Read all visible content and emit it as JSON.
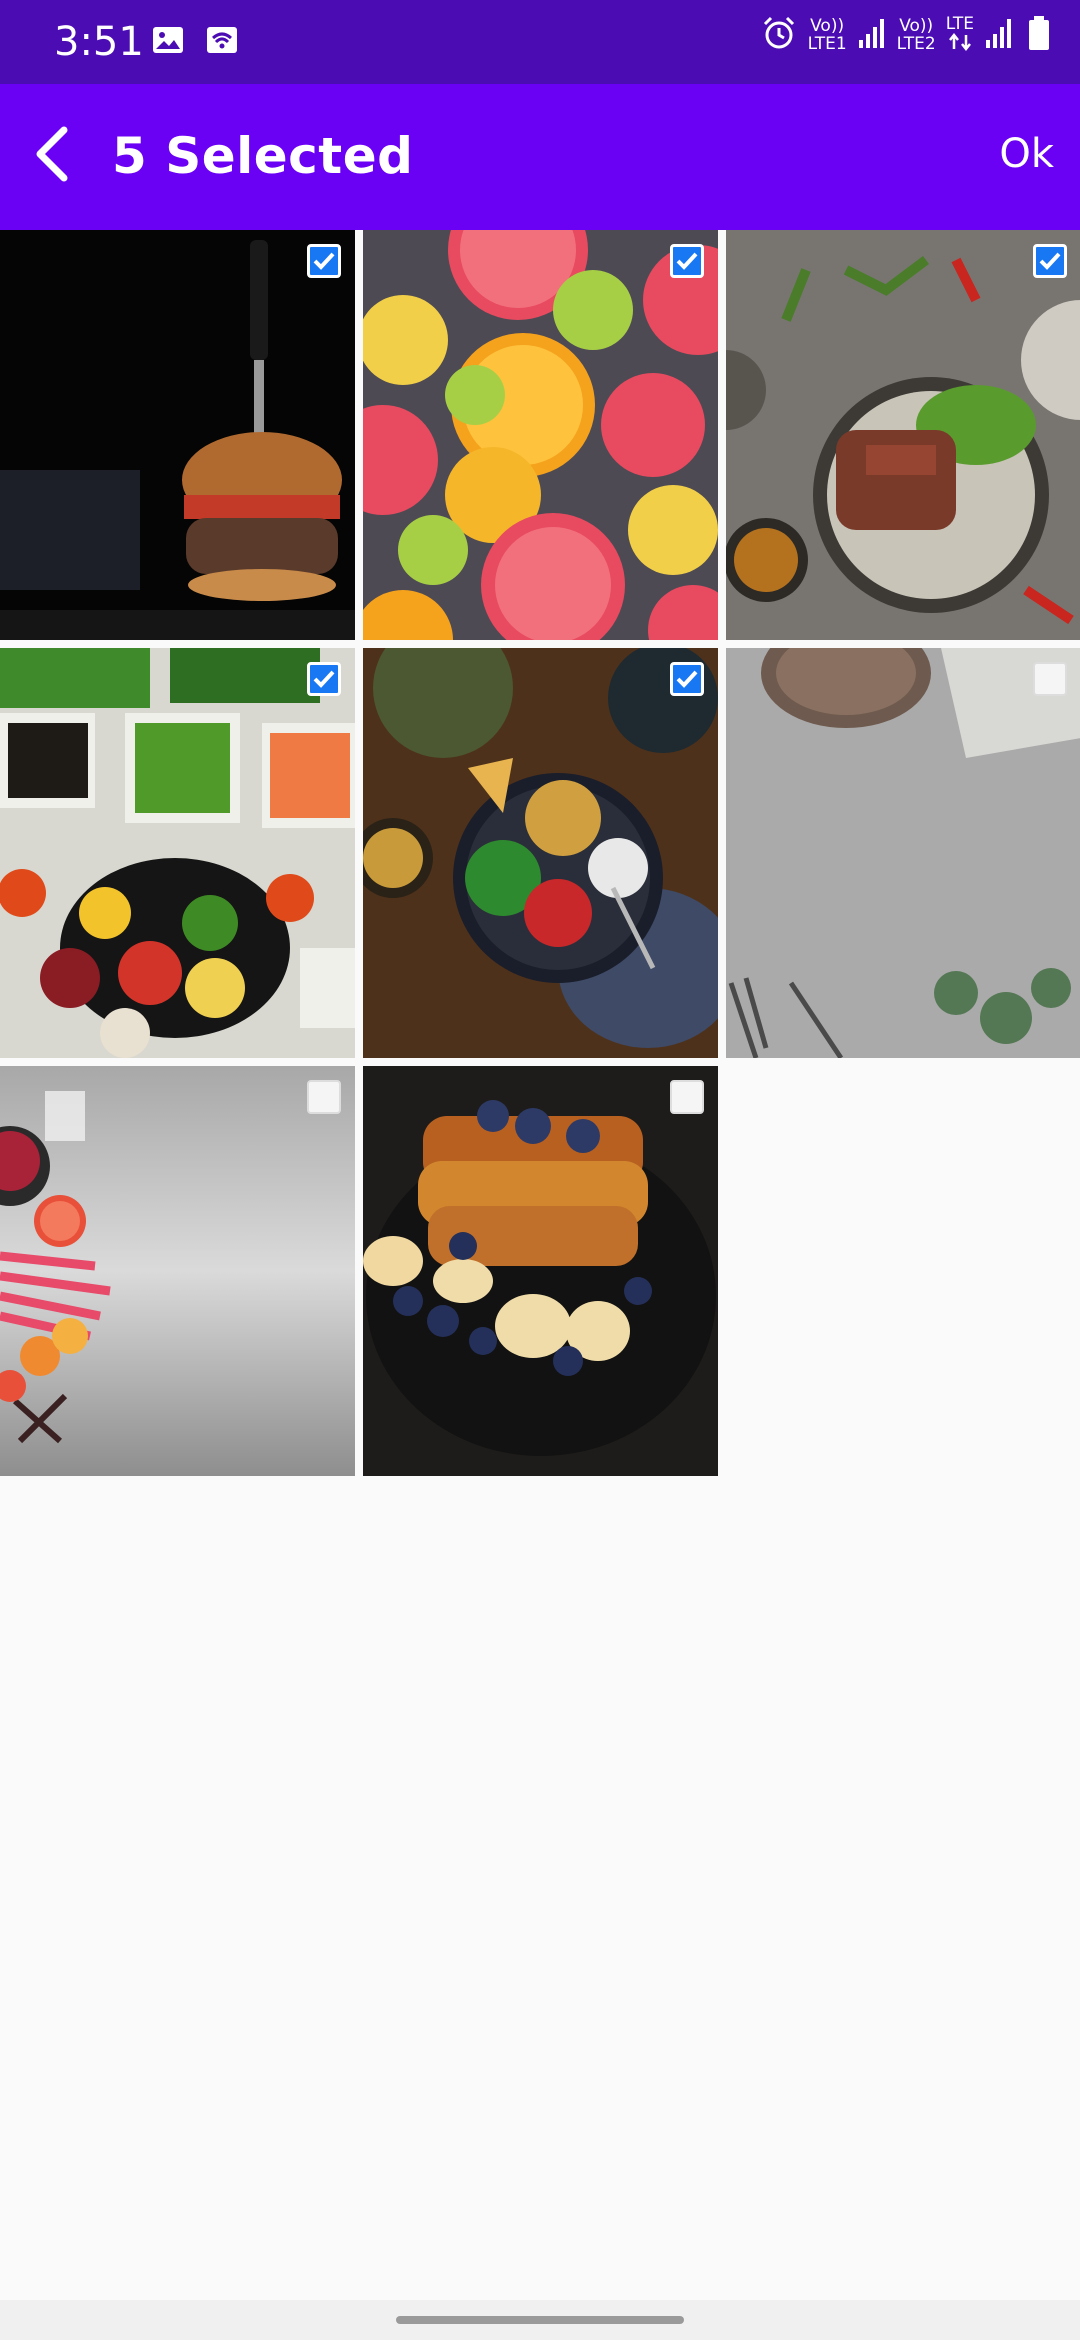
{
  "status_bar": {
    "time": "3:51",
    "network_1_top": "Vo))",
    "network_1_bottom": "LTE1",
    "network_2_top": "Vo))",
    "network_2_bottom": "LTE2",
    "network_3_top": "LTE",
    "icons": [
      "image-icon",
      "wifi-icon",
      "alarm-icon",
      "signal-icon",
      "signal-icon",
      "battery-icon"
    ]
  },
  "toolbar": {
    "title": "5 Selected",
    "ok_label": "Ok",
    "back_icon": "chevron-left-icon"
  },
  "colors": {
    "status_bar": "#4b0db3",
    "toolbar": "#6a00f4",
    "checkbox_checked": "#1877f2",
    "background": "#fafafa"
  },
  "gallery": {
    "items": [
      {
        "subject": "burger",
        "selected": true
      },
      {
        "subject": "citrus-slices",
        "selected": true
      },
      {
        "subject": "steak-plate",
        "selected": true
      },
      {
        "subject": "vegetable-platter",
        "selected": true
      },
      {
        "subject": "chickpea-bowl",
        "selected": true
      },
      {
        "subject": "empty-plate-table",
        "selected": false
      },
      {
        "subject": "fruit-corner",
        "selected": false
      },
      {
        "subject": "french-toast",
        "selected": false
      }
    ]
  }
}
